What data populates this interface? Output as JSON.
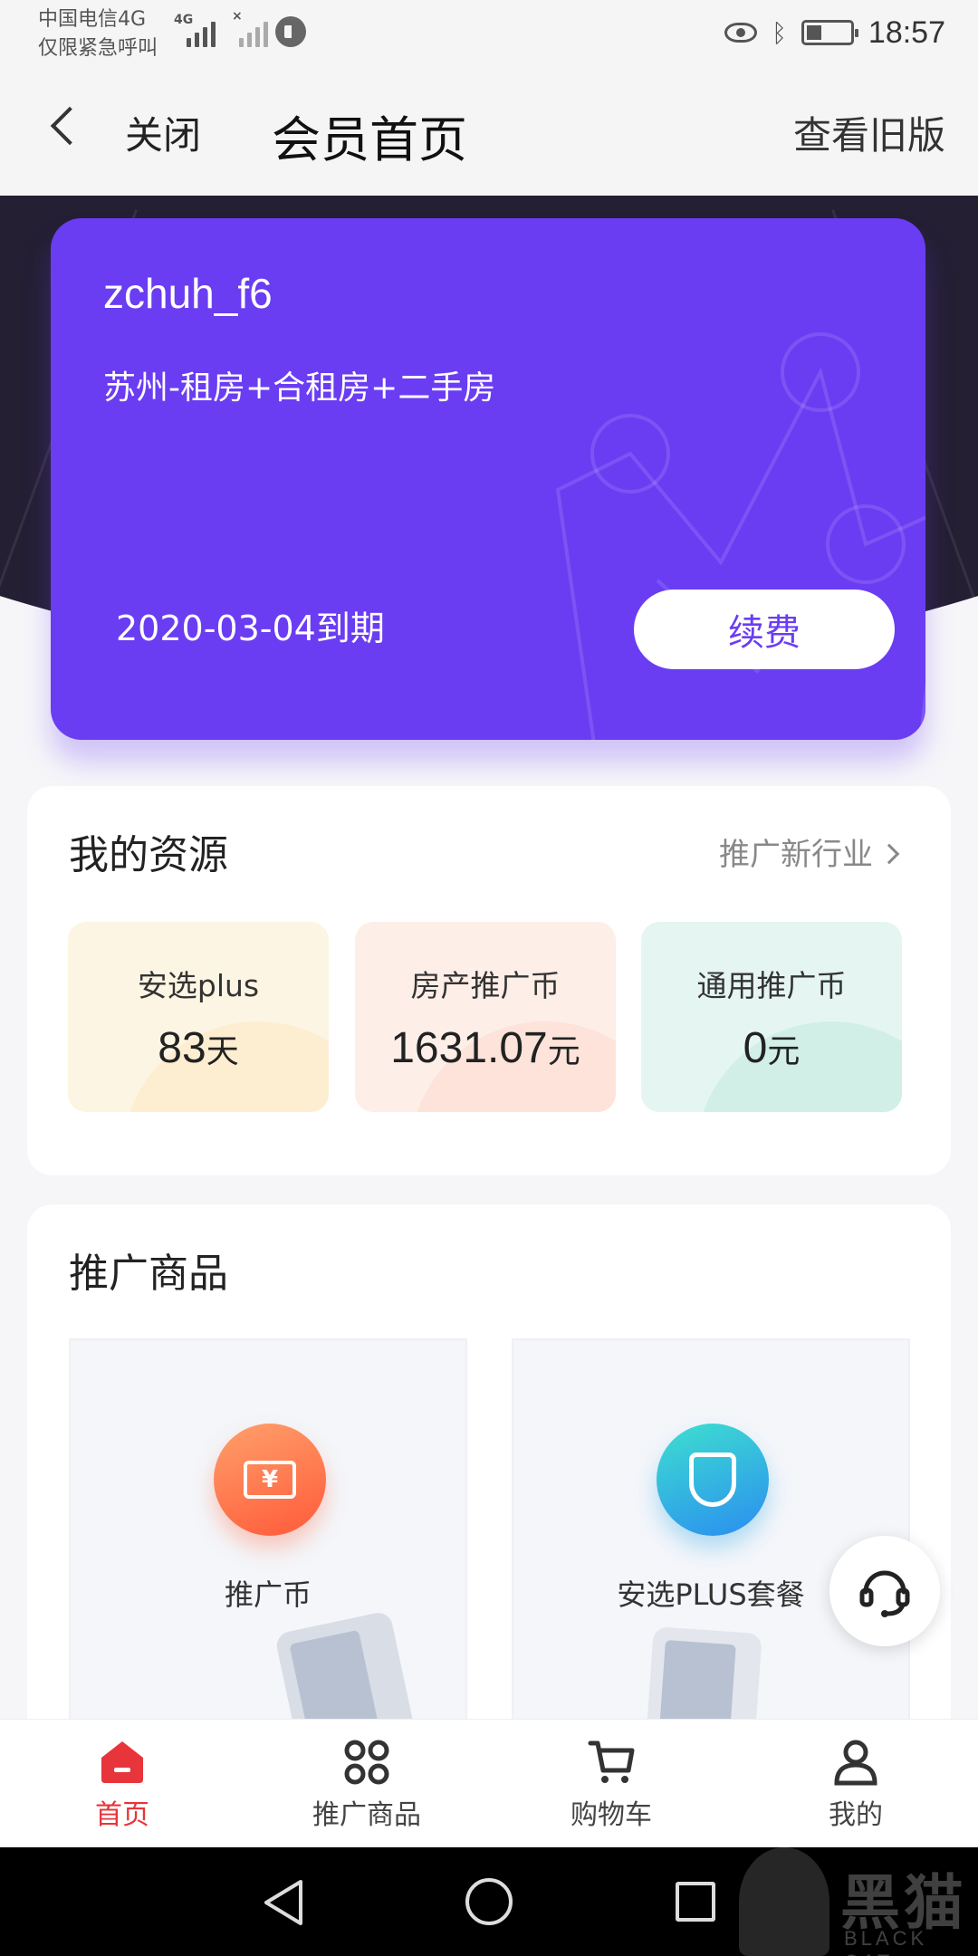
{
  "status_bar": {
    "carrier_line1": "中国电信4G",
    "carrier_line2": "仅限紧急呼叫",
    "sig1_label": "4G",
    "sig2_label": "×",
    "time": "18:57"
  },
  "header": {
    "close_label": "关闭",
    "title": "会员首页",
    "old_version_label": "查看旧版"
  },
  "member_card": {
    "username": "zchuh_f6",
    "package": "苏州-租房+合租房+二手房",
    "expire_text": "2020-03-04到期",
    "renew_label": "续费",
    "accent_color": "#6a3df3"
  },
  "resources": {
    "title": "我的资源",
    "more_label": "推广新行业",
    "items": [
      {
        "label": "安选plus",
        "value": "83",
        "unit": "天"
      },
      {
        "label": "房产推广币",
        "value": "1631.07",
        "unit": "元"
      },
      {
        "label": "通用推广币",
        "value": "0",
        "unit": "元"
      }
    ]
  },
  "products": {
    "title": "推广商品",
    "items": [
      {
        "label": "推广币",
        "icon": "yuan-ticket-icon",
        "icon_text": "¥"
      },
      {
        "label": "安选PLUS套餐",
        "icon": "shield-icon"
      }
    ]
  },
  "tabs": [
    {
      "label": "首页",
      "icon": "home-icon",
      "active": true
    },
    {
      "label": "推广商品",
      "icon": "grid-icon"
    },
    {
      "label": "购物车",
      "icon": "cart-icon"
    },
    {
      "label": "我的",
      "icon": "user-icon"
    }
  ],
  "colors": {
    "active_tab": "#e8343b",
    "dark_band": "#241f33"
  },
  "watermark": {
    "text": "黑猫",
    "subtext": "BLACK CAT"
  }
}
